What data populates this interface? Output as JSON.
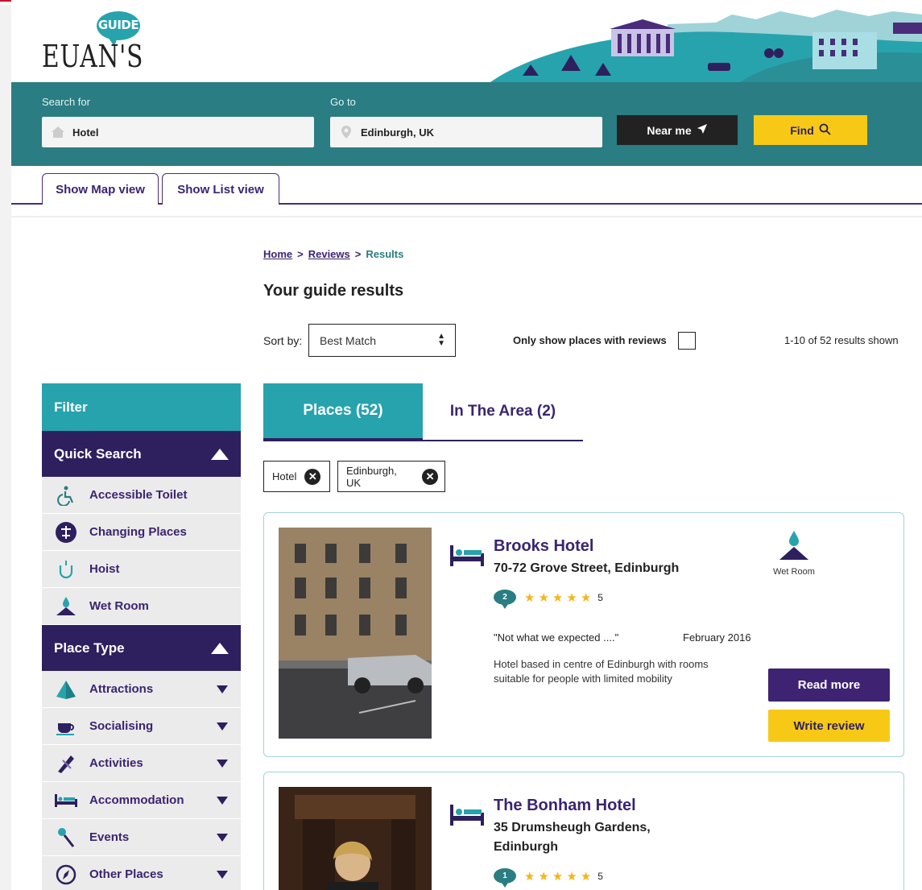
{
  "brand": {
    "guide": "GUIDE",
    "name": "EUAN'S"
  },
  "search": {
    "search_for_label": "Search for",
    "search_for_value": "Hotel",
    "go_to_label": "Go to",
    "go_to_value": "Edinburgh, UK",
    "near_me": "Near me",
    "find": "Find"
  },
  "view_tabs": {
    "map": "Show Map view",
    "list": "Show List view"
  },
  "breadcrumb": {
    "home": "Home",
    "sep": ">",
    "reviews": "Reviews",
    "current": "Results"
  },
  "page_title": "Your guide results",
  "sort": {
    "label": "Sort by:",
    "value": "Best Match"
  },
  "only_reviews_label": "Only show places with reviews",
  "results_count": "1-10 of 52 results shown",
  "sidebar": {
    "filter": "Filter",
    "quick_search": {
      "title": "Quick Search",
      "items": [
        {
          "label": "Accessible Toilet",
          "icon": "accessible-toilet-icon"
        },
        {
          "label": "Changing Places",
          "icon": "changing-places-icon"
        },
        {
          "label": "Hoist",
          "icon": "hoist-icon"
        },
        {
          "label": "Wet Room",
          "icon": "wet-room-icon"
        }
      ]
    },
    "place_type": {
      "title": "Place Type",
      "items": [
        {
          "label": "Attractions",
          "icon": "attractions-icon"
        },
        {
          "label": "Socialising",
          "icon": "socialising-icon"
        },
        {
          "label": "Activities",
          "icon": "activities-icon"
        },
        {
          "label": "Accommodation",
          "icon": "accommodation-icon"
        },
        {
          "label": "Events",
          "icon": "events-icon"
        },
        {
          "label": "Other Places",
          "icon": "other-places-icon"
        }
      ]
    }
  },
  "result_tabs": {
    "places": "Places (52)",
    "area": "In The Area (2)"
  },
  "chips": [
    "Hotel",
    "Edinburgh, UK"
  ],
  "results": [
    {
      "name": "Brooks Hotel",
      "address": "70-72 Grove Street, Edinburgh",
      "review_count": "2",
      "rating": "5",
      "quote": "\"Not what we expected ....\"",
      "date": "February 2016",
      "description": "Hotel based in centre of Edinburgh with rooms suitable for people with limited mobility",
      "feature": "Wet Room",
      "read_more": "Read more",
      "write_review": "Write review"
    },
    {
      "name": "The Bonham Hotel",
      "address": "35 Drumsheugh Gardens, Edinburgh",
      "review_count": "1",
      "rating": "5"
    }
  ],
  "colors": {
    "teal": "#27a3ad",
    "dark_teal": "#2a7d82",
    "purple": "#2e1f5e",
    "yellow": "#f7c916",
    "star": "#f7b516"
  }
}
